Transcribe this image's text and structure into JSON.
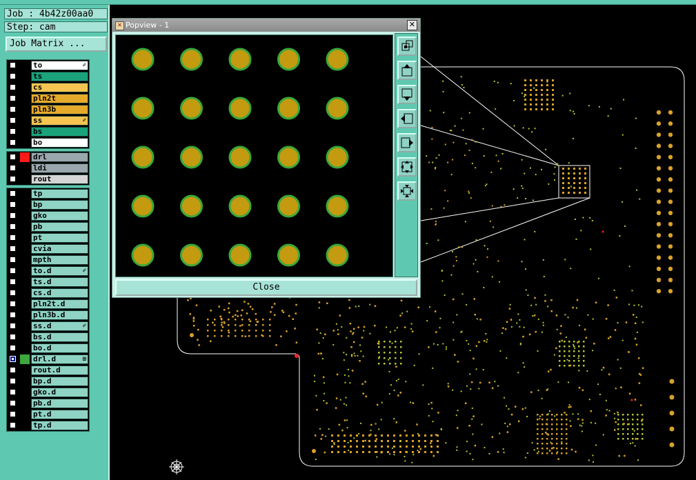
{
  "job": {
    "label": "Job",
    "value": "4b42z00aa0"
  },
  "step": {
    "label": "Step",
    "value": "cam"
  },
  "job_matrix_label": "Job Matrix ...",
  "layer_groups": [
    {
      "layers": [
        {
          "name": "to",
          "color": "#ffffff",
          "tag": "✐"
        },
        {
          "name": "ts",
          "color": "#1aa37a"
        },
        {
          "name": "cs",
          "color": "#f5c451"
        },
        {
          "name": "pln2t",
          "color": "#e6aa2a"
        },
        {
          "name": "pln3b",
          "color": "#e6aa2a"
        },
        {
          "name": "ss",
          "color": "#f5c451",
          "tag": "✐"
        },
        {
          "name": "bs",
          "color": "#1aa37a"
        },
        {
          "name": "bo",
          "color": "#ffffff"
        }
      ]
    },
    {
      "layers": [
        {
          "name": "drl",
          "color": "#9aa7ad",
          "swatch": "#ff1a1a"
        },
        {
          "name": "ldi",
          "color": "#9aa7ad"
        },
        {
          "name": "rout",
          "color": "#d5d5d5"
        }
      ]
    },
    {
      "layers": [
        {
          "name": "tp",
          "color": "#8fd3c4"
        },
        {
          "name": "bp",
          "color": "#8fd3c4"
        },
        {
          "name": "gko",
          "color": "#8fd3c4"
        },
        {
          "name": "pb",
          "color": "#8fd3c4"
        },
        {
          "name": "pt",
          "color": "#8fd3c4"
        },
        {
          "name": "cvia",
          "color": "#8fd3c4"
        },
        {
          "name": "mpth",
          "color": "#8fd3c4"
        },
        {
          "name": "to.d",
          "color": "#8fd3c4",
          "tag": "✐"
        },
        {
          "name": "ts.d",
          "color": "#8fd3c4"
        },
        {
          "name": "cs.d",
          "color": "#8fd3c4"
        },
        {
          "name": "pln2t.d",
          "color": "#8fd3c4"
        },
        {
          "name": "pln3b.d",
          "color": "#8fd3c4"
        },
        {
          "name": "ss.d",
          "color": "#8fd3c4",
          "tag": "✐"
        },
        {
          "name": "bs.d",
          "color": "#8fd3c4"
        },
        {
          "name": "bo.d",
          "color": "#8fd3c4"
        },
        {
          "name": "drl.d",
          "color": "#8fd3c4",
          "swatch": "#3ea83e",
          "tag": "⊞",
          "selected": true
        },
        {
          "name": "rout.d",
          "color": "#8fd3c4"
        },
        {
          "name": "bp.d",
          "color": "#8fd3c4"
        },
        {
          "name": "gko.d",
          "color": "#8fd3c4"
        },
        {
          "name": "pb.d",
          "color": "#8fd3c4"
        },
        {
          "name": "pt.d",
          "color": "#8fd3c4"
        },
        {
          "name": "tp.d",
          "color": "#8fd3c4"
        }
      ]
    }
  ],
  "popview": {
    "title": "Popview - 1",
    "close_label": "Close",
    "pad_grid": {
      "rows": 5,
      "cols": 5
    },
    "pad_fill": "#c49a10",
    "pad_ring": "#3aa83a",
    "tools": [
      {
        "name": "zoom-window-icon"
      },
      {
        "name": "pan-up-icon"
      },
      {
        "name": "pan-down-icon"
      },
      {
        "name": "pan-left-icon"
      },
      {
        "name": "pan-right-icon"
      },
      {
        "name": "zoom-fit-icon"
      },
      {
        "name": "zoom-center-icon"
      }
    ]
  },
  "colors": {
    "panel": "#5ec9b0",
    "board_outline": "#ffffff",
    "pad": "#d9a12a",
    "via": "#b6c934",
    "hole": "#ff2020"
  }
}
